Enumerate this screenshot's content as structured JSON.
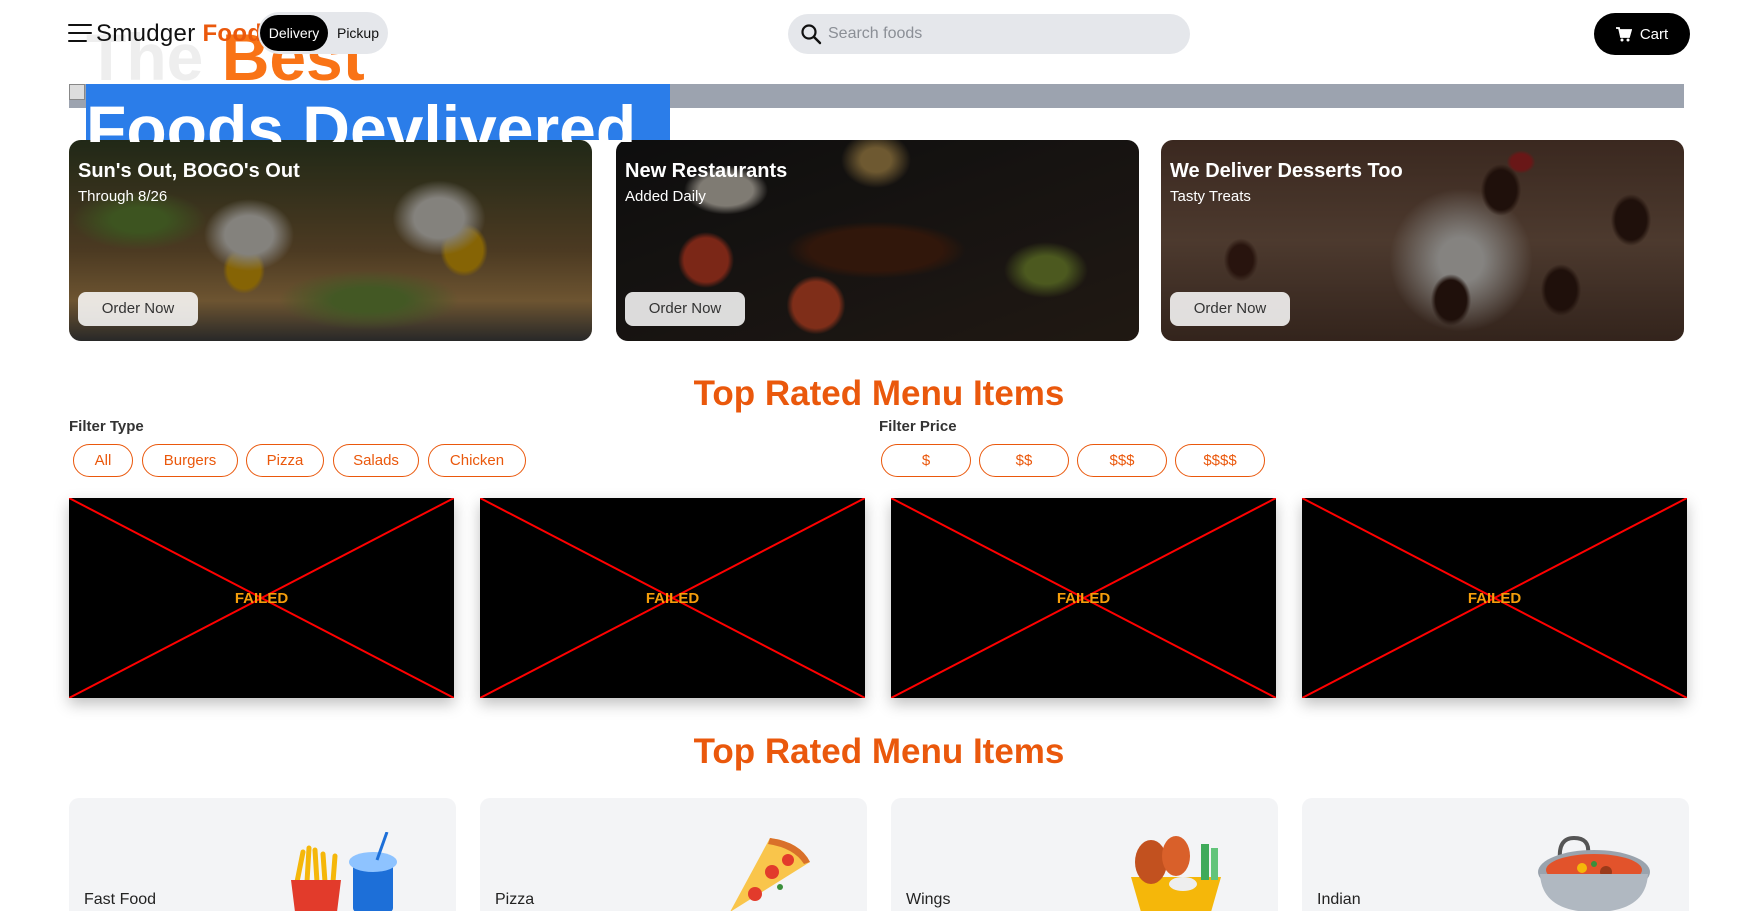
{
  "brand": {
    "name_part1": "Smudger",
    "name_part2": "Food"
  },
  "order_mode": {
    "options": [
      "Delivery",
      "Pickup"
    ],
    "selected": "Delivery"
  },
  "search": {
    "placeholder": "Search foods",
    "value": ""
  },
  "cart": {
    "label": "Cart"
  },
  "hero": {
    "title_part1": "The",
    "title_part2": "Best",
    "subtitle": "Foods Devlivered"
  },
  "promos": [
    {
      "title": "Sun's Out, BOGO's Out",
      "subtitle": "Through 8/26",
      "button": "Order Now"
    },
    {
      "title": "New Restaurants",
      "subtitle": "Added Daily",
      "button": "Order Now"
    },
    {
      "title": "We Deliver Desserts Too",
      "subtitle": "Tasty Treats",
      "button": "Order Now"
    }
  ],
  "top_rated": {
    "title": "Top Rated Menu Items",
    "filter_type": {
      "label": "Filter Type",
      "options": [
        "All",
        "Burgers",
        "Pizza",
        "Salads",
        "Chicken"
      ]
    },
    "filter_price": {
      "label": "Filter Price",
      "options": [
        "$",
        "$$",
        "$$$",
        "$$$$"
      ]
    },
    "items": [
      {
        "image_status": "FAILED"
      },
      {
        "image_status": "FAILED"
      },
      {
        "image_status": "FAILED"
      },
      {
        "image_status": "FAILED"
      }
    ]
  },
  "categories_section": {
    "title": "Top Rated Menu Items",
    "items": [
      {
        "label": "Fast Food",
        "icon": "fast-food-icon"
      },
      {
        "label": "Pizza",
        "icon": "pizza-icon"
      },
      {
        "label": "Wings",
        "icon": "wings-icon"
      },
      {
        "label": "Indian",
        "icon": "indian-curry-icon"
      }
    ]
  },
  "colors": {
    "accent": "#ea580c",
    "hero_orange": "#f97316",
    "hero_blue": "#2b7de9",
    "failed_cross": "#ff0000",
    "failed_text": "#f59e0b"
  }
}
